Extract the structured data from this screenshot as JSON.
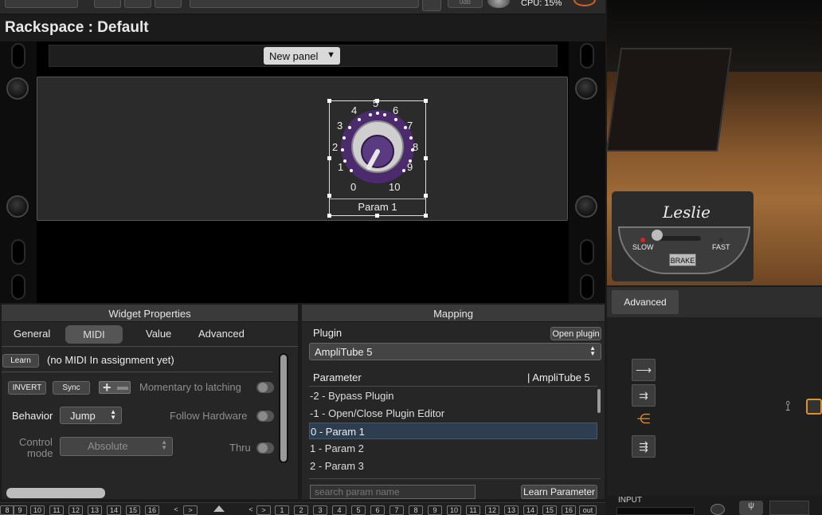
{
  "topbar": {
    "cpu_text": "CPU:  15%",
    "db_label": "0dB"
  },
  "rackspace": {
    "title": "Rackspace : Default"
  },
  "panel": {
    "new_panel_label": "New panel",
    "dropdown_arrow": "▼"
  },
  "knob": {
    "scale": [
      "0",
      "1",
      "2",
      "3",
      "4",
      "5",
      "6",
      "7",
      "8",
      "9",
      "10"
    ],
    "label": "Param 1",
    "accent_color": "#4b2a6e"
  },
  "leslie": {
    "logo": "Leslie",
    "slow": "SLOW",
    "fast": "FAST",
    "brake": "BRAKE"
  },
  "right_panel": {
    "advanced_tab": "Advanced",
    "input_label": "INPUT"
  },
  "widget_properties": {
    "title": "Widget Properties",
    "tabs": [
      "General",
      "MIDI",
      "Value",
      "Advanced"
    ],
    "active_tab": "MIDI",
    "learn_button": "Learn",
    "midi_status": "(no MIDI In assignment yet)",
    "invert_button": "INVERT",
    "sync_button": "Sync",
    "momentary_label": "Momentary to latching",
    "behavior_label": "Behavior",
    "behavior_value": "Jump",
    "follow_hardware_label": "Follow Hardware",
    "control_mode_label_1": "Control",
    "control_mode_label_2": "mode",
    "control_mode_value": "Absolute",
    "thru_label": "Thru"
  },
  "mapping": {
    "title": "Mapping",
    "plugin_label": "Plugin",
    "open_plugin_button": "Open plugin",
    "plugin_value": "AmpliTube 5",
    "parameter_header": "Parameter",
    "plugin_header": "| AmpliTube 5",
    "params": [
      "-2 - Bypass Plugin",
      "-1 - Open/Close Plugin Editor",
      "0 - Param 1",
      "1 - Param 2",
      "2 - Param 3"
    ],
    "selected_index": 2,
    "search_placeholder": "search param name",
    "learn_parameter_button": "Learn Parameter"
  },
  "bottom": {
    "left_pages": [
      "8",
      "9",
      "10",
      "11",
      "12",
      "13",
      "14",
      "15",
      "16"
    ],
    "right_pages": [
      "1",
      "2",
      "3",
      "4",
      "5",
      "6",
      "7",
      "8",
      "9",
      "10",
      "11",
      "12",
      "13",
      "14",
      "15",
      "16"
    ],
    "out_label": "out",
    "prev": "<",
    "next": ">"
  }
}
